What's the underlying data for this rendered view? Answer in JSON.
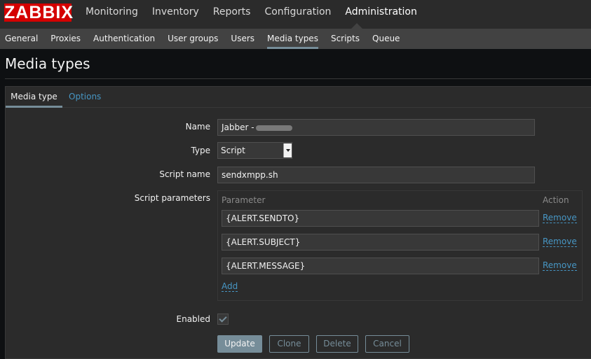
{
  "app": {
    "logo_text": "ZABBIX"
  },
  "main_menu": [
    {
      "label": "Monitoring"
    },
    {
      "label": "Inventory"
    },
    {
      "label": "Reports"
    },
    {
      "label": "Configuration"
    },
    {
      "label": "Administration",
      "active": true
    }
  ],
  "sub_menu": [
    {
      "label": "General"
    },
    {
      "label": "Proxies"
    },
    {
      "label": "Authentication"
    },
    {
      "label": "User groups"
    },
    {
      "label": "Users"
    },
    {
      "label": "Media types",
      "active": true
    },
    {
      "label": "Scripts"
    },
    {
      "label": "Queue"
    }
  ],
  "page": {
    "title": "Media types"
  },
  "tabs": [
    {
      "label": "Media type",
      "active": true
    },
    {
      "label": "Options"
    }
  ],
  "form": {
    "name_label": "Name",
    "name_value": "Jabber -",
    "type_label": "Type",
    "type_value": "Script",
    "script_name_label": "Script name",
    "script_name_value": "sendxmpp.sh",
    "script_params_label": "Script parameters",
    "params_header_parameter": "Parameter",
    "params_header_action": "Action",
    "params": [
      {
        "value": "{ALERT.SENDTO}",
        "action": "Remove"
      },
      {
        "value": "{ALERT.SUBJECT}",
        "action": "Remove"
      },
      {
        "value": "{ALERT.MESSAGE}",
        "action": "Remove"
      }
    ],
    "add_label": "Add",
    "enabled_label": "Enabled",
    "enabled": true
  },
  "buttons": {
    "update": "Update",
    "clone": "Clone",
    "delete": "Delete",
    "cancel": "Cancel"
  },
  "colors": {
    "logo_bg": "#d40000",
    "accent": "#768d99",
    "link": "#4796c4"
  }
}
